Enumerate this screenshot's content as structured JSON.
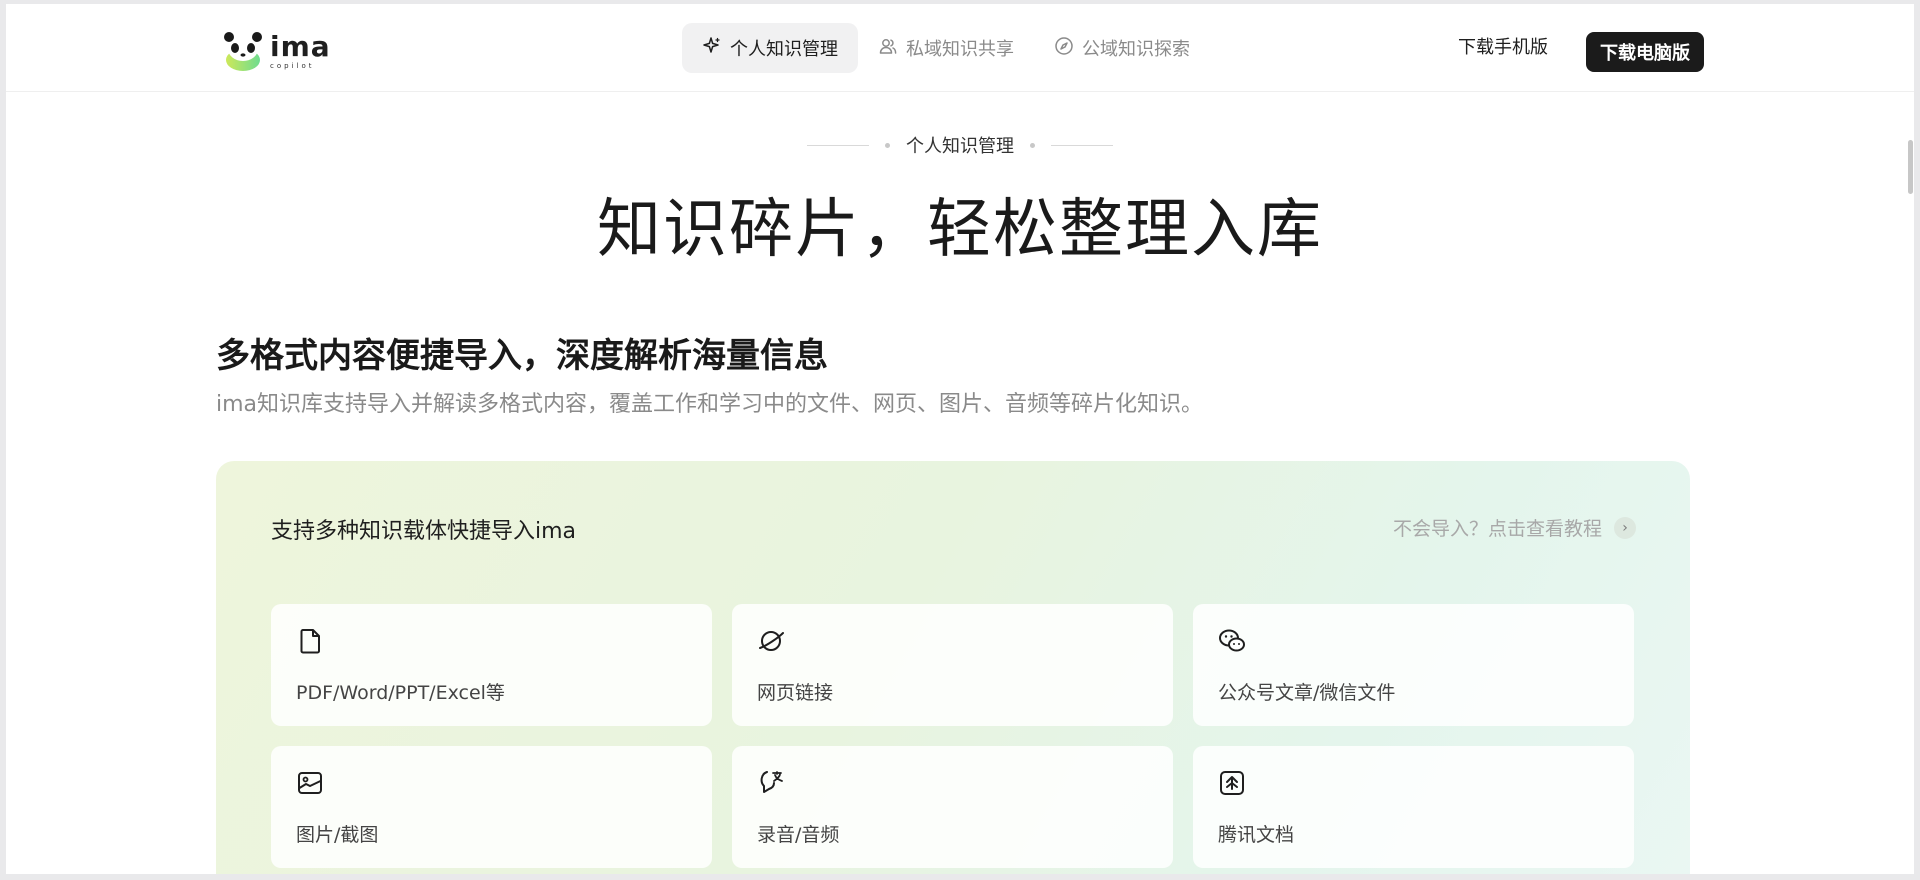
{
  "header": {
    "logo_text": "ima",
    "logo_subtext": "copilot",
    "nav": [
      {
        "label": "个人知识管理",
        "icon": "sparkle-icon",
        "active": true
      },
      {
        "label": "私域知识共享",
        "icon": "users-icon",
        "active": false
      },
      {
        "label": "公域知识探索",
        "icon": "compass-icon",
        "active": false
      }
    ],
    "download_mobile": "下载手机版",
    "download_pc": "下载电脑版"
  },
  "hero": {
    "eyebrow": "个人知识管理",
    "title": "知识碎片，轻松整理入库"
  },
  "section": {
    "title": "多格式内容便捷导入，深度解析海量信息",
    "description": "ima知识库支持导入并解读多格式内容，覆盖工作和学习中的文件、网页、图片、音频等碎片化知识。"
  },
  "panel": {
    "title": "支持多种知识载体快捷导入ima",
    "help_link": "不会导入？点击查看教程",
    "cards": [
      {
        "label": "PDF/Word/PPT/Excel等",
        "icon": "document-icon"
      },
      {
        "label": "网页链接",
        "icon": "planet-icon"
      },
      {
        "label": "公众号文章/微信文件",
        "icon": "wechat-icon"
      },
      {
        "label": "图片/截图",
        "icon": "image-icon"
      },
      {
        "label": "录音/音频",
        "icon": "voice-translate-icon"
      },
      {
        "label": "腾讯文档",
        "icon": "tencent-docs-icon"
      }
    ]
  },
  "colors": {
    "primary_button": "#1b1b1b",
    "active_tab_bg": "#f1f1f2",
    "panel_gradient_start": "#eef5dc",
    "panel_gradient_end": "#eaf7f3"
  }
}
